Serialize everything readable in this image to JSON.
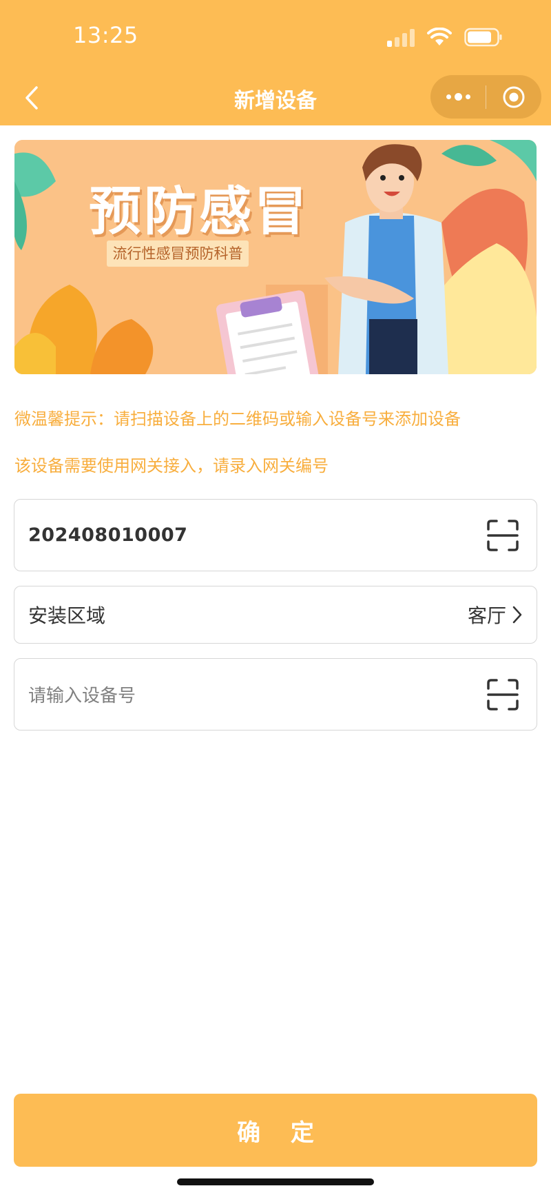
{
  "status_bar": {
    "time": "13:25"
  },
  "nav": {
    "title": "新增设备"
  },
  "banner": {
    "title": "预防感冒",
    "subtitle": "流行性感冒预防科普"
  },
  "tips": {
    "line1": "微温馨提示：请扫描设备上的二维码或输入设备号来添加设备",
    "line2": "该设备需要使用网关接入，请录入网关编号"
  },
  "form": {
    "gateway_value": "202408010007",
    "region_label": "安装区域",
    "region_value": "客厅",
    "device_placeholder": "请输入设备号"
  },
  "actions": {
    "confirm_label": "确 定"
  },
  "colors": {
    "accent": "#FDBC54",
    "tip_text": "#F8AE3E",
    "banner_bg": "#FBC287"
  },
  "icons": [
    "back-chevron-icon",
    "more-dots-icon",
    "close-target-icon",
    "scan-icon",
    "chevron-right-icon",
    "signal-icon",
    "wifi-icon",
    "battery-icon"
  ]
}
